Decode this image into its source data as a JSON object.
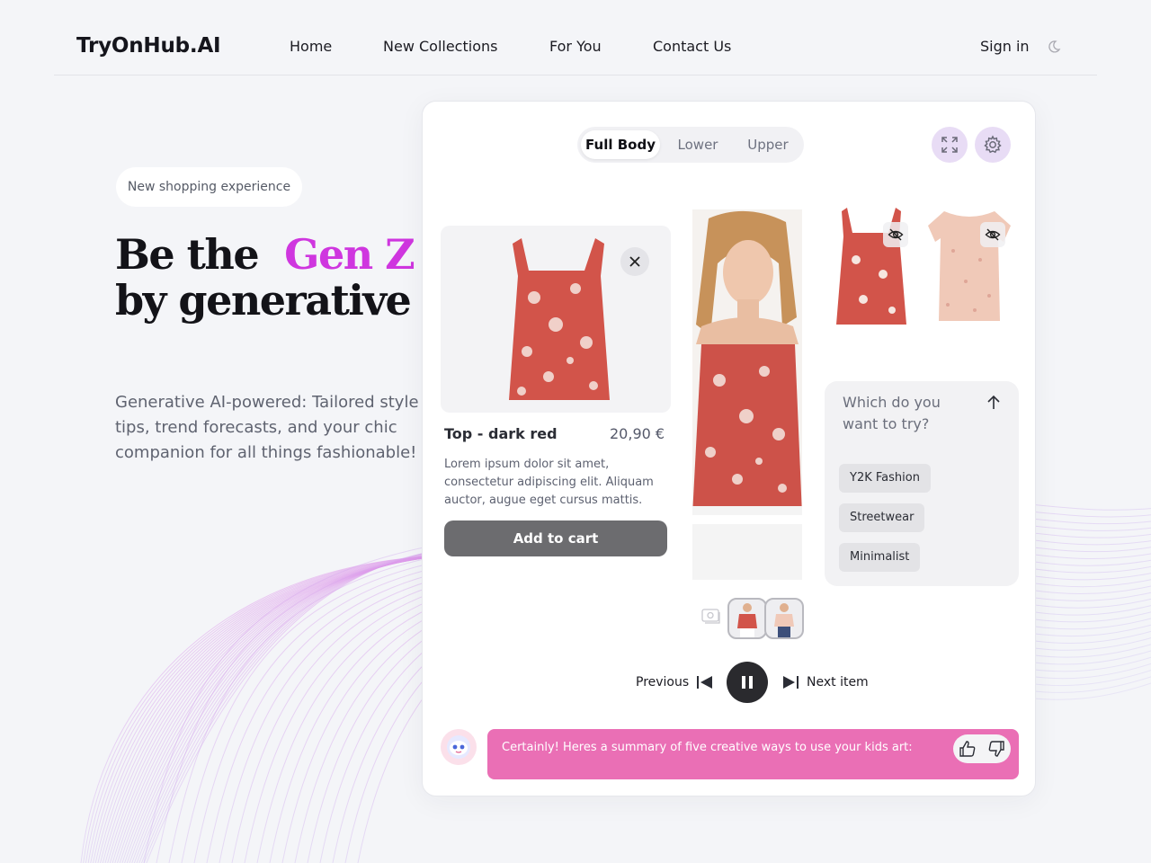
{
  "brand": {
    "logo": "TryOnHub.AI"
  },
  "nav": {
    "links": [
      "Home",
      "New Collections",
      "For You",
      "Contact Us"
    ],
    "signin": "Sign in",
    "theme_icon": "moon-icon"
  },
  "hero": {
    "pill": "New shopping experience",
    "title_1": "Be the",
    "title_accent": "Gen Z Fashionista",
    "title_2": "by generative AI!",
    "subtitle": "Generative AI-powered: Tailored style tips, trend forecasts, and your chic companion for all things fashionable!",
    "accent_color": "#cf36df"
  },
  "tryon": {
    "tabs": [
      {
        "label": "Full Body",
        "active": true
      },
      {
        "label": "Lower",
        "active": false
      },
      {
        "label": "Upper",
        "active": false
      }
    ],
    "icons": {
      "expand": "expand-icon",
      "settings": "settings-icon"
    },
    "product": {
      "name": "Top - dark red",
      "price": "20,90 €",
      "description": "Lorem ipsum dolor sit amet, consectetur adipiscing elit. Aliquam auctor, augue eget cursus mattis.",
      "cart_label": "Add to cart"
    },
    "suggest": {
      "question": "Which do you want to try?",
      "chips": [
        "Y2K Fashion",
        "Streetwear",
        "Minimalist"
      ]
    },
    "player": {
      "prev_label": "Previous",
      "next_label": "Next item"
    },
    "chat": {
      "message": "Certainly! Heres a summary of five creative ways to use your kids art:"
    },
    "colors": {
      "chat_bg": "#ea6fb5",
      "button_bg": "#e8dcf5"
    }
  }
}
